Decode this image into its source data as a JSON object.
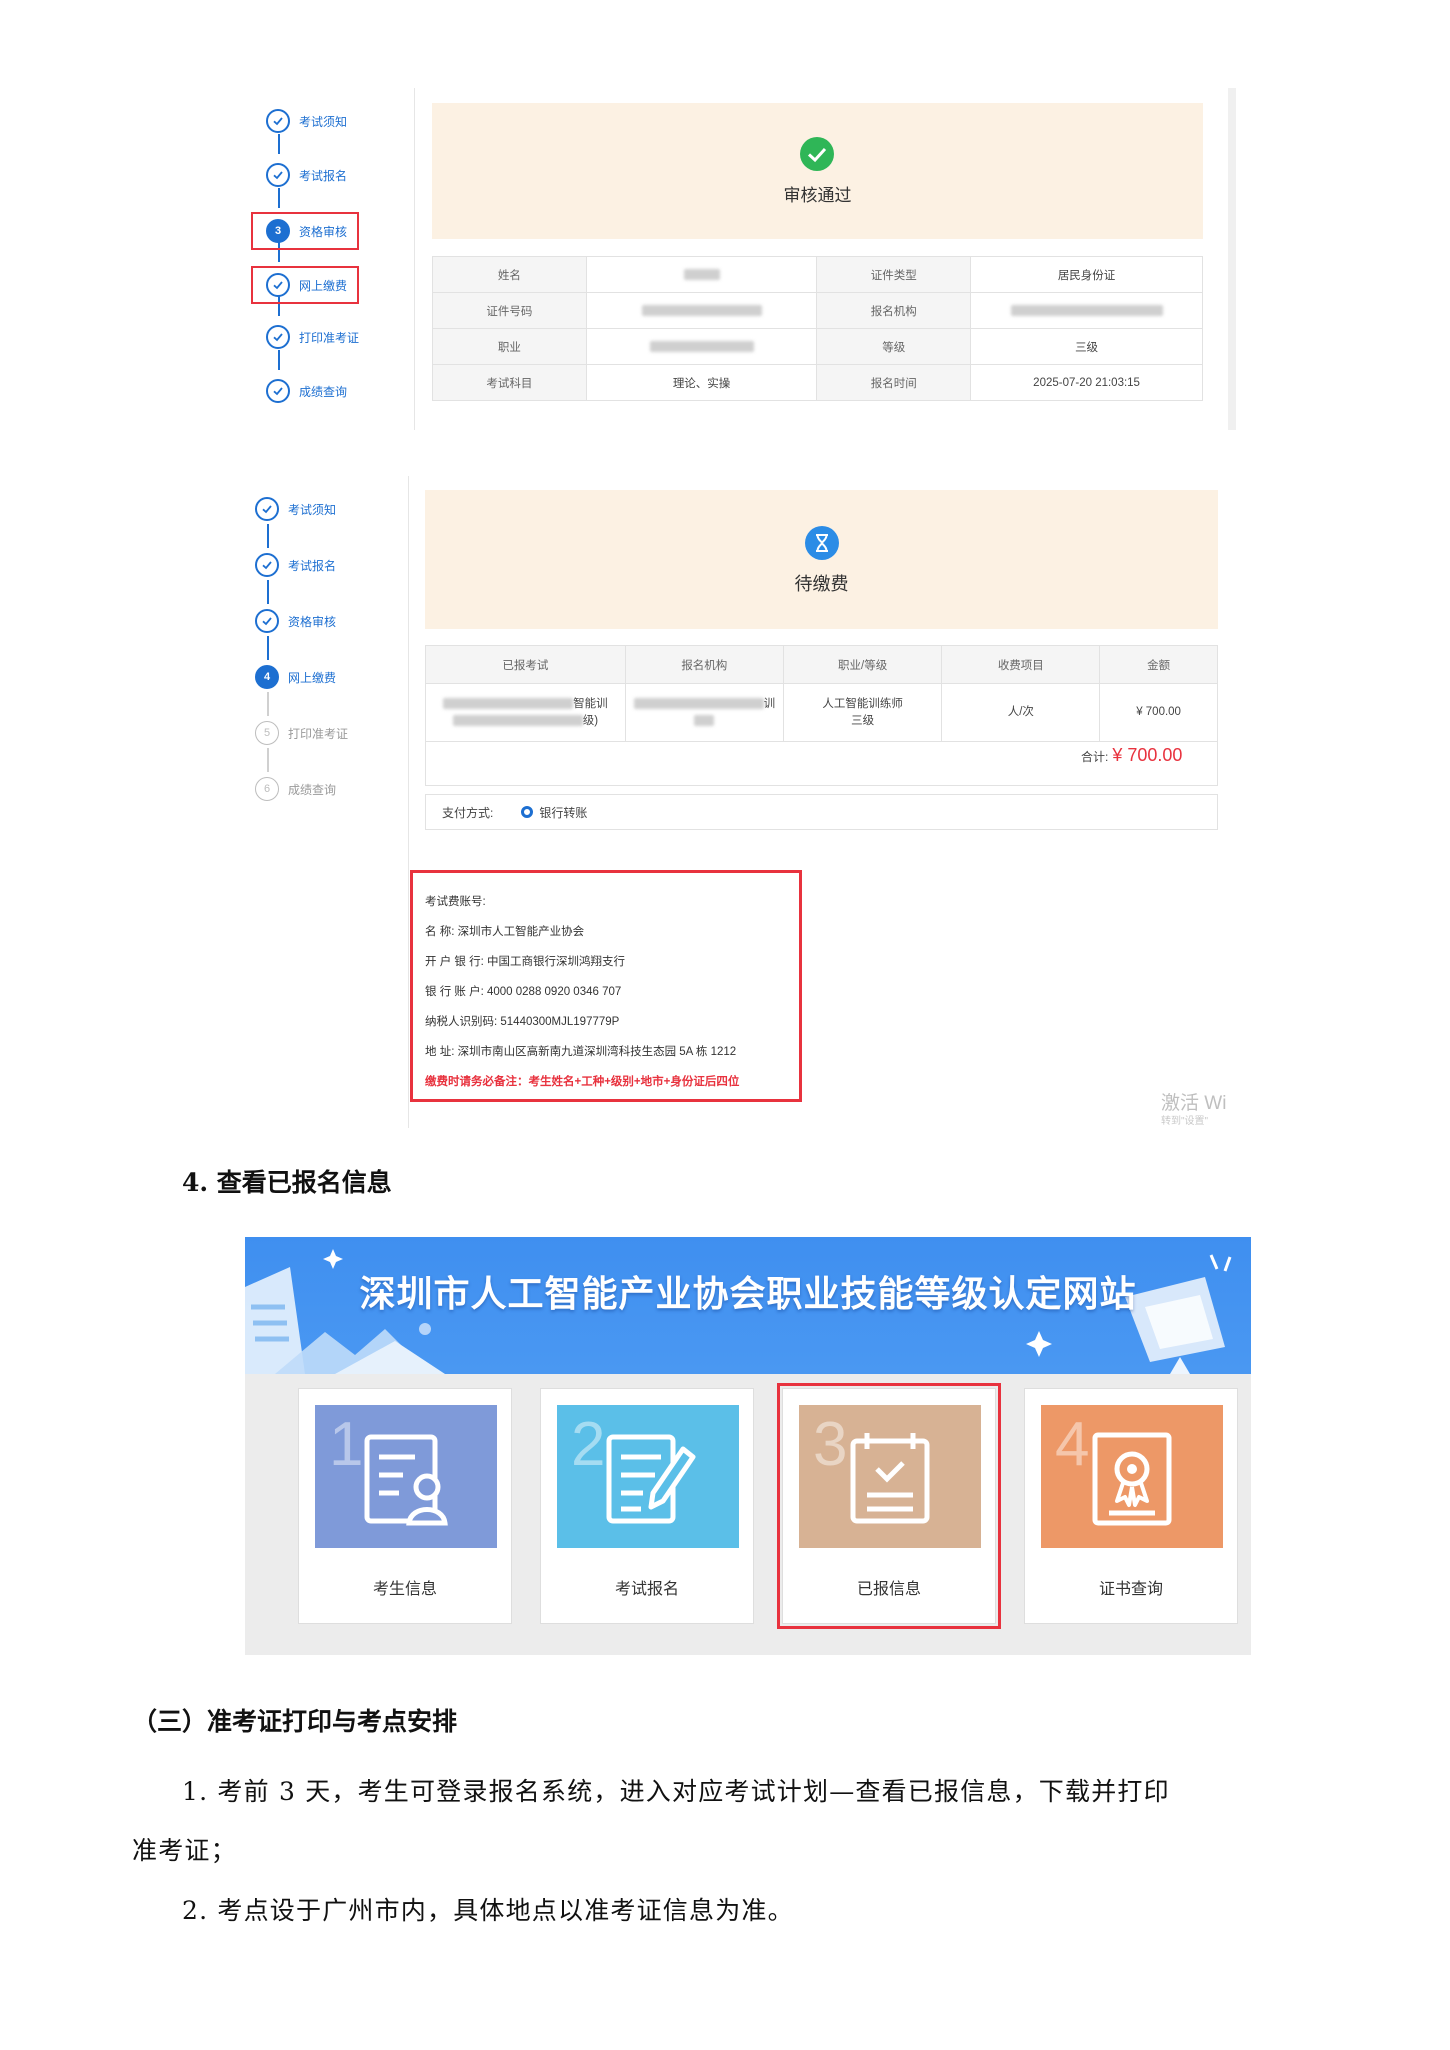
{
  "panel1": {
    "steps": [
      "考试须知",
      "考试报名",
      "资格审核",
      "网上缴费",
      "打印准考证",
      "成绩查询"
    ],
    "current_step_number": "3",
    "status_title": "审核通过",
    "info_rows": [
      [
        "姓名",
        "",
        "证件类型",
        "居民身份证"
      ],
      [
        "证件号码",
        "",
        "报名机构",
        ""
      ],
      [
        "职业",
        "",
        "等级",
        "三级"
      ],
      [
        "考试科目",
        "理论、实操",
        "报名时间",
        "2025-07-20 21:03:15"
      ]
    ]
  },
  "panel2": {
    "steps": [
      "考试须知",
      "考试报名",
      "资格审核",
      "网上缴费",
      "打印准考证",
      "成绩查询"
    ],
    "current_step_number": "4",
    "pending_numbers": [
      "5",
      "6"
    ],
    "status_title": "待缴费",
    "fee_headers": [
      "已报考试",
      "报名机构",
      "职业/等级",
      "收费项目",
      "金额"
    ],
    "fee_row": {
      "exam_line1": "智能训",
      "exam_line2": "级)",
      "org_line1": "训",
      "occupation": "人工智能训练师",
      "level": "三级",
      "item": "人/次",
      "amount": "¥ 700.00"
    },
    "total_label": "合计:",
    "total_amount": "¥ 700.00",
    "payment_label": "支付方式:",
    "payment_option": "银行转账",
    "account": {
      "heading": "考试费账号:",
      "name": "名 称:  深圳市人工智能产业协会",
      "bank": "开 户 银 行:  中国工商银行深圳鸿翔支行",
      "number": "银 行 账 户:  4000 0288 0920 0346 707",
      "tax_id": "纳税人识别码:  51440300MJL197779P",
      "address": "地 址:  深圳市南山区高新南九道深圳湾科技生态园 5A 栋 1212",
      "note": "缴费时请务必备注：考生姓名+工种+级别+地市+身份证后四位"
    },
    "watermark_line1": "激活 Wi",
    "watermark_line2": "转到\"设置\""
  },
  "section4_heading": "4. 查看已报名信息",
  "portal": {
    "site_title": "深圳市人工智能产业协会职业技能等级认定网站",
    "cards": [
      {
        "number": "1",
        "label": "考生信息",
        "color": "#7f9ad9"
      },
      {
        "number": "2",
        "label": "考试报名",
        "color": "#5bbfe8"
      },
      {
        "number": "3",
        "label": "已报信息",
        "color": "#d7b294"
      },
      {
        "number": "4",
        "label": "证书查询",
        "color": "#ed9867"
      }
    ]
  },
  "section3_heading": "（三）准考证打印与考点安排",
  "para1_line1": "1. 考前 3 天，考生可登录报名系统，进入对应考试计划—查看已报信息，下载并打印",
  "para1_line2": "准考证；",
  "para2": "2. 考点设于广州市内，具体地点以准考证信息为准。"
}
